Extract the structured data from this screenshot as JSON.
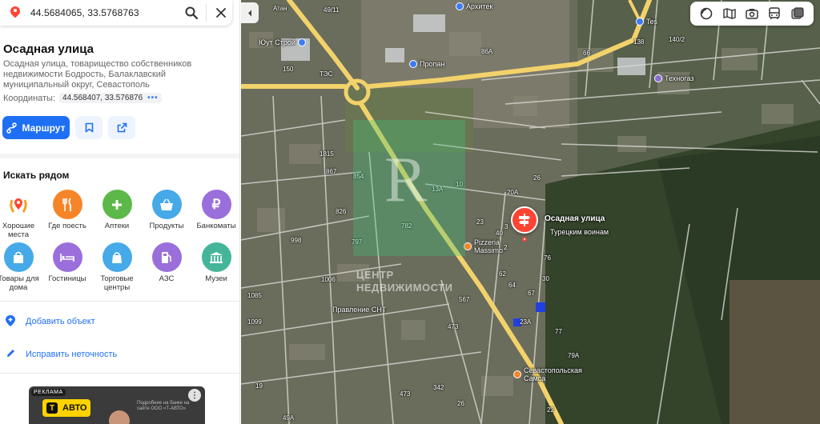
{
  "search": {
    "query": "44.5684065, 33.5768763"
  },
  "place": {
    "title": "Осадная улица",
    "description": "Осадная улица, товарищество собственников недвижимости Бодрость, Балаклавский муниципальный округ, Севастополь",
    "coords_label": "Координаты:",
    "coords_value": "44.568407, 33.576876",
    "route_label": "Маршрут"
  },
  "nearby": {
    "title": "Искать рядом",
    "categories": [
      {
        "label": "Хорошие места",
        "icon": "laurel-pin-icon",
        "color": "#ffffff"
      },
      {
        "label": "Где поесть",
        "icon": "fork-knife-icon",
        "color": "#f6852a"
      },
      {
        "label": "Аптеки",
        "icon": "plus-icon",
        "color": "#5cb848"
      },
      {
        "label": "Продукты",
        "icon": "basket-icon",
        "color": "#46a9e8"
      },
      {
        "label": "Банкоматы",
        "icon": "ruble-icon",
        "color": "#9b6fdb"
      },
      {
        "label": "Товары для дома",
        "icon": "bag-icon",
        "color": "#46a9e8"
      },
      {
        "label": "Гостиницы",
        "icon": "bed-icon",
        "color": "#9b6fdb"
      },
      {
        "label": "Торговые центры",
        "icon": "shopping-bag-icon",
        "color": "#46a9e8"
      },
      {
        "label": "АЗС",
        "icon": "fuel-icon",
        "color": "#9b6fdb"
      },
      {
        "label": "Музеи",
        "icon": "museum-icon",
        "color": "#45b59a"
      }
    ]
  },
  "actions": {
    "add_object": "Добавить объект",
    "fix_error": "Исправить неточность"
  },
  "ad": {
    "badge": "РЕКЛАМА",
    "brand": "АВТО",
    "brand_letter": "Т",
    "fine_print": "Подробнее на банке на сайте ООО «Т-АВТО»"
  },
  "map": {
    "marker_title": "Осадная улица",
    "marker_sub": "Турецким воинам",
    "watermark": "ЦЕНТР НЕДВИЖИМОСТИ",
    "watermark_logo": "R",
    "pois": [
      {
        "name": "Архитек",
        "style": "blue"
      },
      {
        "name": "Юут Строй",
        "style": "blue"
      },
      {
        "name": "Пропан",
        "style": "blue"
      },
      {
        "name": "Техногаз",
        "style": "purple"
      },
      {
        "name": "Tes",
        "style": "blue"
      },
      {
        "name": "ТЭС",
        "style": "none"
      },
      {
        "name": "Pizzeria Massimo",
        "style": "orange"
      },
      {
        "name": "Правление СНТ",
        "style": "none"
      },
      {
        "name": "Севастопольская Самса",
        "style": "orange"
      },
      {
        "name": "Атан",
        "style": "none"
      }
    ],
    "house_numbers": [
      "49/11",
      "86А",
      "66",
      "138",
      "140/2",
      "150",
      "1815",
      "867",
      "854",
      "826",
      "998",
      "797",
      "782",
      "13А",
      "10",
      "20А",
      "26",
      "23",
      "40",
      "2",
      "76",
      "67",
      "1006",
      "1085",
      "1099",
      "567",
      "473",
      "342",
      "473",
      "23А",
      "77",
      "79А",
      "22",
      "26",
      "49А",
      "19",
      "62",
      "64",
      "30",
      "3"
    ],
    "colors": {
      "accent": "#1f6ff5",
      "marker": "#ff4433",
      "watermark": "#3cc878"
    }
  }
}
